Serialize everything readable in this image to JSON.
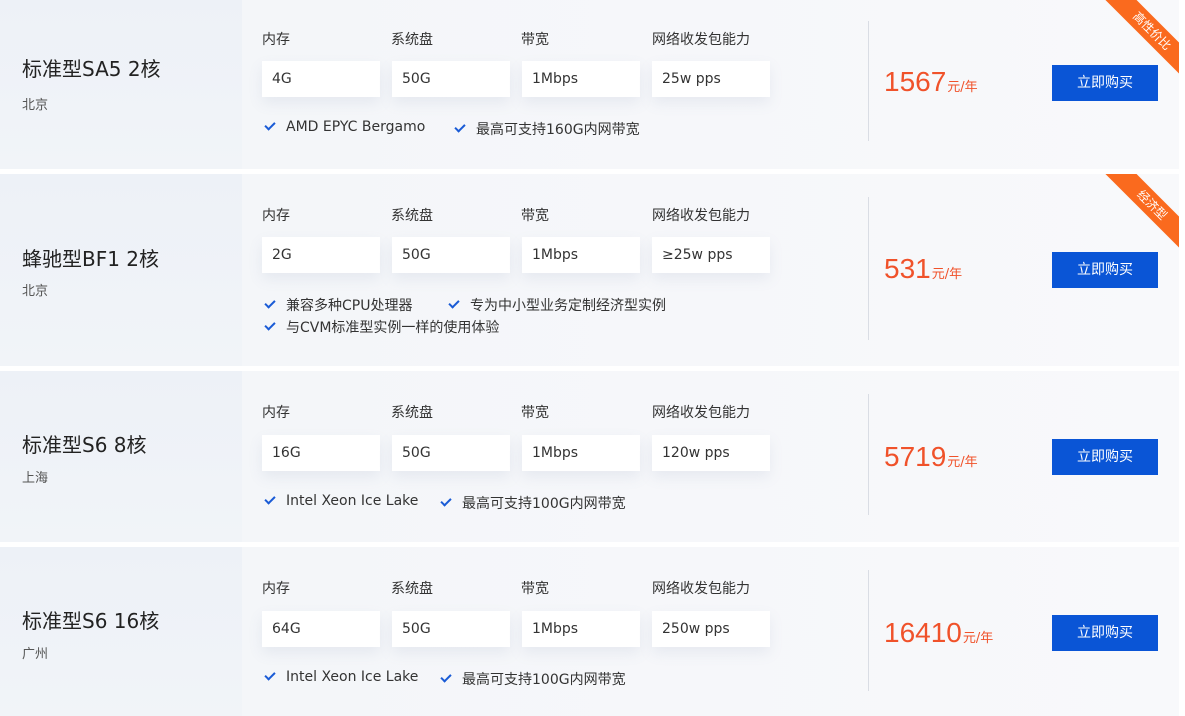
{
  "spec_labels": {
    "memory": "内存",
    "disk": "系统盘",
    "bandwidth": "带宽",
    "pps": "网络收发包能力"
  },
  "buy_label": "立即购买",
  "price_unit": "元/年",
  "colors": {
    "accent_blue": "#0a55d6",
    "price_orange": "#f0522a",
    "ribbon_orange": "#fa6a1e"
  },
  "products": [
    {
      "title": "标准型SA5 2核",
      "region": "北京",
      "ribbon": "高性价比",
      "memory": "4G",
      "disk": "50G",
      "bandwidth": "1Mbps",
      "pps": "25w pps",
      "features": [
        "AMD EPYC Bergamo",
        "最高可支持160G内网带宽"
      ],
      "price": "1567"
    },
    {
      "title": "蜂驰型BF1 2核",
      "region": "北京",
      "ribbon": "经济型",
      "memory": "2G",
      "disk": "50G",
      "bandwidth": "1Mbps",
      "pps": "≥25w pps",
      "features": [
        "兼容多种CPU处理器",
        "专为中小型业务定制经济型实例",
        "与CVM标准型实例一样的使用体验"
      ],
      "price": "531"
    },
    {
      "title": "标准型S6 8核",
      "region": "上海",
      "memory": "16G",
      "disk": "50G",
      "bandwidth": "1Mbps",
      "pps": "120w pps",
      "features": [
        "Intel Xeon Ice Lake",
        "最高可支持100G内网带宽"
      ],
      "price": "5719"
    },
    {
      "title": "标准型S6 16核",
      "region": "广州",
      "memory": "64G",
      "disk": "50G",
      "bandwidth": "1Mbps",
      "pps": "250w pps",
      "features": [
        "Intel Xeon Ice Lake",
        "最高可支持100G内网带宽"
      ],
      "price": "16410"
    }
  ]
}
